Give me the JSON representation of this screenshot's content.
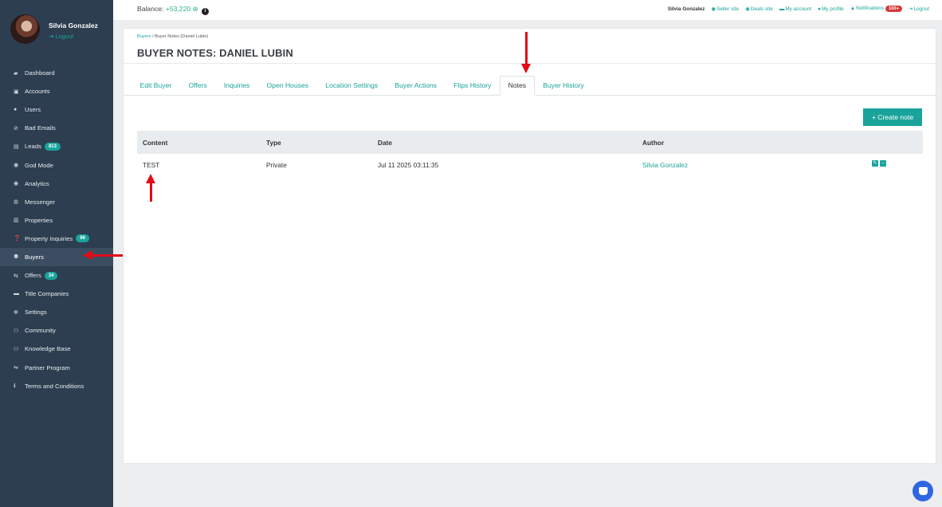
{
  "sidebar": {
    "profile_name": "Silvia Gonzalez",
    "logout_label": "Logout",
    "items": [
      {
        "icon": "dashboard-icon",
        "glyph": "▰",
        "label": "Dashboard"
      },
      {
        "icon": "briefcase-icon",
        "glyph": "▣",
        "label": "Accounts"
      },
      {
        "icon": "user-icon",
        "glyph": "●",
        "label": "Users"
      },
      {
        "icon": "ban-icon",
        "glyph": "⊘",
        "label": "Bad Emails"
      },
      {
        "icon": "id-card-icon",
        "glyph": "▤",
        "label": "Leads",
        "badge": "813"
      },
      {
        "icon": "globe-icon",
        "glyph": "◉",
        "label": "God Mode"
      },
      {
        "icon": "globe-icon",
        "glyph": "◉",
        "label": "Analytics"
      },
      {
        "icon": "messenger-icon",
        "glyph": "◍",
        "label": "Messenger"
      },
      {
        "icon": "building-icon",
        "glyph": "▥",
        "label": "Properties"
      },
      {
        "icon": "question-icon",
        "glyph": "❓",
        "label": "Property Inquiries",
        "badge": "96"
      },
      {
        "icon": "buyers-icon",
        "glyph": "⚉",
        "label": "Buyers"
      },
      {
        "icon": "handshake-icon",
        "glyph": "⇆",
        "label": "Offers",
        "badge": "34"
      },
      {
        "icon": "title-card-icon",
        "glyph": "▬",
        "label": "Title Companies"
      },
      {
        "icon": "gear-icon",
        "glyph": "✻",
        "label": "Settings"
      },
      {
        "icon": "community-icon",
        "glyph": "⚇",
        "label": "Community"
      },
      {
        "icon": "knowledge-icon",
        "glyph": "⚇",
        "label": "Knowledge Base"
      },
      {
        "icon": "partner-icon",
        "glyph": "⇋",
        "label": "Partner Program"
      },
      {
        "icon": "info-icon",
        "glyph": "ℹ",
        "label": "Terms and Conditions"
      }
    ]
  },
  "topbar": {
    "balance_label": "Balance:",
    "balance_amount": "+53,220",
    "user_name": "Silvia Gonzalez",
    "links": {
      "seller_site": "Seller site",
      "deals_site": "Deals site",
      "my_account": "My account",
      "my_profile": "My profile",
      "notifications": "Notifications",
      "notifications_count": "100+",
      "logout": "Logout"
    }
  },
  "page": {
    "breadcrumb_link": "Buyers",
    "breadcrumb_separator": " / ",
    "breadcrumb_current": "Buyer Notes (Daniel Lubin)",
    "title": "BUYER NOTES: DANIEL LUBIN",
    "tabs": [
      "Edit Buyer",
      "Offers",
      "Inquiries",
      "Open Houses",
      "Location Settings",
      "Buyer Actions",
      "Flips History",
      "Notes",
      "Buyer History"
    ],
    "active_tab": "Notes",
    "create_button": "+ Create note"
  },
  "notes_table": {
    "columns": [
      "Content",
      "Type",
      "Date",
      "Author"
    ],
    "rows": [
      {
        "content": "TEST",
        "type": "Private",
        "date": "Jul 11 2025 03:11:35",
        "author": "Silvia Gonzalez"
      }
    ]
  },
  "colors": {
    "sidebar_bg": "#2c3e50",
    "accent": "#1aa39b",
    "annotation_arrow": "#e30b17",
    "notification_badge": "#d63a3a"
  }
}
